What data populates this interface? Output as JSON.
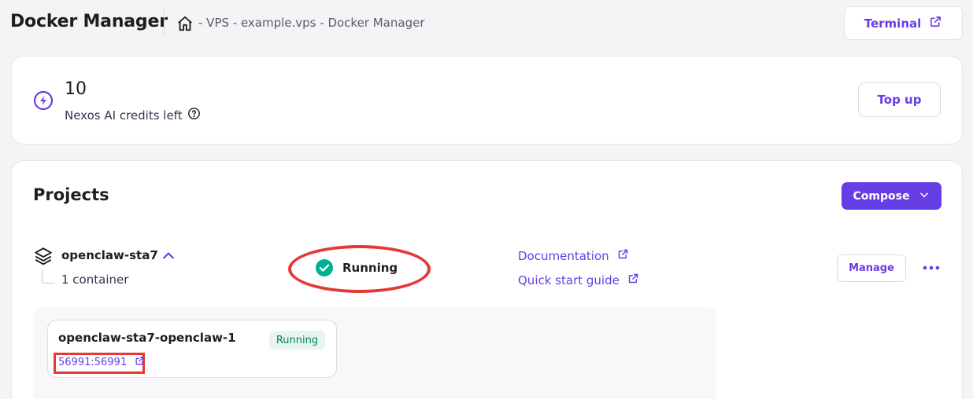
{
  "header": {
    "title": "Docker Manager",
    "breadcrumb": "- VPS - example.vps - Docker Manager",
    "terminal_label": "Terminal"
  },
  "credits": {
    "amount": "10",
    "label": "Nexos AI credits left",
    "topup_label": "Top up"
  },
  "projects": {
    "title": "Projects",
    "compose_label": "Compose",
    "items": [
      {
        "name": "openclaw-sta7",
        "container_count": "1 container",
        "status": "Running",
        "links": {
          "documentation": "Documentation",
          "quick_start": "Quick start guide"
        },
        "manage_label": "Manage",
        "containers": [
          {
            "name": "openclaw-sta7-openclaw-1",
            "status": "Running",
            "port": "56991:56991"
          }
        ]
      }
    ]
  },
  "colors": {
    "accent": "#673de6",
    "success": "#00b090",
    "highlight": "#e53935",
    "badge_bg": "#e8f5ef",
    "badge_text": "#008361"
  },
  "icons": [
    "home-icon",
    "external-link-icon",
    "credits-icon",
    "help-circle-icon",
    "chevron-down-icon",
    "layers-icon",
    "chevron-up-icon",
    "check-circle-icon",
    "more-horizontal-icon"
  ]
}
